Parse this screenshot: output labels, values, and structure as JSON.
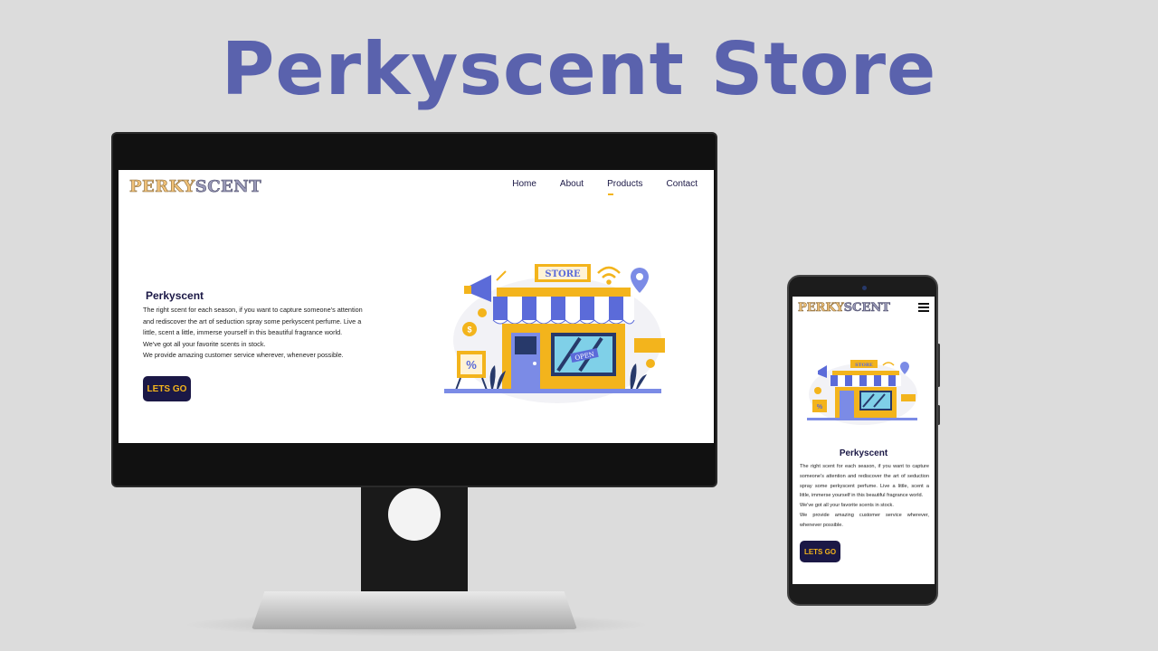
{
  "headline": "Perkyscent Store",
  "brand": {
    "logo_part1": "PERKY",
    "logo_part2": "SCENT"
  },
  "nav": {
    "items": [
      {
        "label": "Home"
      },
      {
        "label": "About"
      },
      {
        "label": "Products",
        "active": true
      },
      {
        "label": "Contact"
      }
    ]
  },
  "hero": {
    "title": "Perkyscent",
    "paragraph_1": "The right scent for each season, if you want to capture someone's attention and rediscover the art of seduction spray some perkyscent perfume. Live a little, scent a little, immerse yourself in this beautiful fragrance world.",
    "paragraph_2": "We've got all your favorite scents in stock.",
    "paragraph_3": "We provide amazing customer service wherever, whenever possible.",
    "cta_label": "LETS GO"
  },
  "illustration": {
    "sign": "STORE",
    "door_sign": "OPEN",
    "discount": "%"
  },
  "colors": {
    "headline": "#5a62ad",
    "nav_text": "#1b1846",
    "cta_bg": "#1b1846",
    "cta_text": "#f3b41c",
    "accent": "#f3b41c",
    "background": "#dcdcdc"
  },
  "icons": [
    "hamburger-menu-icon",
    "megaphone-icon",
    "wifi-icon",
    "location-pin-icon",
    "dollar-coin-icon"
  ]
}
